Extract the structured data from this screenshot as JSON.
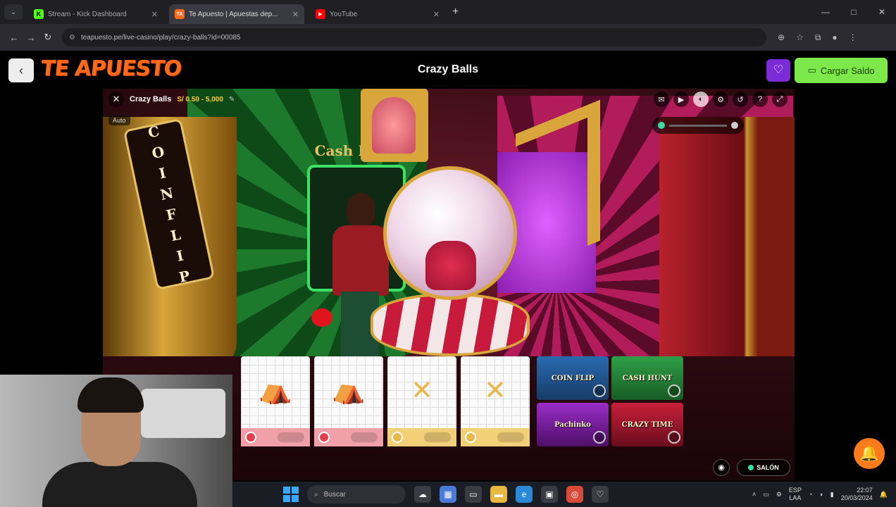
{
  "browser": {
    "tabs": [
      {
        "label": "Stream - Kick Dashboard",
        "favicon": "K",
        "favicon_color": "#53fc18",
        "active": false
      },
      {
        "label": "Te Apuesto | Apuestas dep...",
        "favicon": "TA",
        "favicon_color": "#ff6a1a",
        "active": true
      },
      {
        "label": "YouTube",
        "favicon": "▶",
        "favicon_color": "#ff0000",
        "active": false
      }
    ],
    "url": "teapuesto.pe/live-casino/play/crazy-balls?id=00085",
    "window_controls": [
      "—",
      "□",
      "✕"
    ]
  },
  "site": {
    "logo": "TE APUESTO",
    "page_title": "Crazy Balls",
    "deposit_label": "Cargar Saldo",
    "brand_color": "#ff6a1a",
    "deposit_color": "#7de84a"
  },
  "game": {
    "name": "Crazy Balls",
    "limits": "S/ 0.50 - 5,000",
    "sub_label": "Auto",
    "coin_flip_letters": [
      "C",
      "O",
      "I",
      "N",
      "F",
      "L",
      "I",
      "P"
    ],
    "sign_text": "Cash Hunt",
    "icons": [
      "chat-icon",
      "video-icon",
      "settings-toggle-icon",
      "gear-icon",
      "history-icon",
      "help-icon",
      "fullscreen-icon"
    ],
    "cards": [
      {
        "type": "tent",
        "symbol": "⛺"
      },
      {
        "type": "tent",
        "symbol": "⛺"
      },
      {
        "type": "x",
        "symbol": "✕"
      },
      {
        "type": "x",
        "symbol": "✕"
      }
    ],
    "bonuses": [
      {
        "label": "COIN FLIP",
        "color": "blue"
      },
      {
        "label": "CASH HUNT",
        "color": "green"
      },
      {
        "label": "Pachinko",
        "color": "purple"
      },
      {
        "label": "CRAZY TIME",
        "color": "red"
      }
    ],
    "salon_label": "SALÓN"
  },
  "taskbar": {
    "search_placeholder": "Buscar",
    "language": "ESP",
    "language_sub": "LAA",
    "time": "22:07",
    "date": "20/03/2024"
  }
}
